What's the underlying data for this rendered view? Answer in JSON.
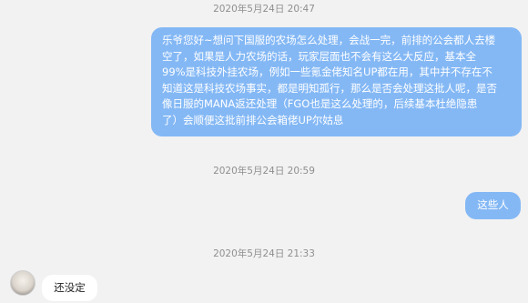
{
  "messages": [
    {
      "timestamp": "2020年5月24日 20:47",
      "direction": "outgoing",
      "lines": [
        "乐爷您好~想问下国服的农场怎么处理，会战一完，前排的公会都人去楼",
        "空了，如果是人力农场的话，玩家层面也不会有这么大反应，基本全",
        "99%是科技外挂农场，例如一些氪金佬知名UP都在用，其中并不存在不",
        "知道这是科技农场事实，都是明知孤行，那么是否会处理这批人呢，是否",
        "像日服的MANA返还处理（FGO也是这么处理的，后续基本杜绝隐患",
        "了）会顺便这批前排公会箱佬UP尔姑息"
      ]
    },
    {
      "timestamp": "2020年5月24日 20:59",
      "direction": "outgoing",
      "lines": [
        "这些人"
      ]
    },
    {
      "timestamp": "2020年5月24日 21:33",
      "direction": "incoming",
      "avatar_icon": "user-avatar",
      "lines": [
        "还没定"
      ]
    }
  ],
  "colors": {
    "outgoing_bubble": "#84b8f5",
    "incoming_bubble": "#ffffff",
    "background": "#f2f2f2",
    "timestamp_text": "#8f8f8f"
  }
}
